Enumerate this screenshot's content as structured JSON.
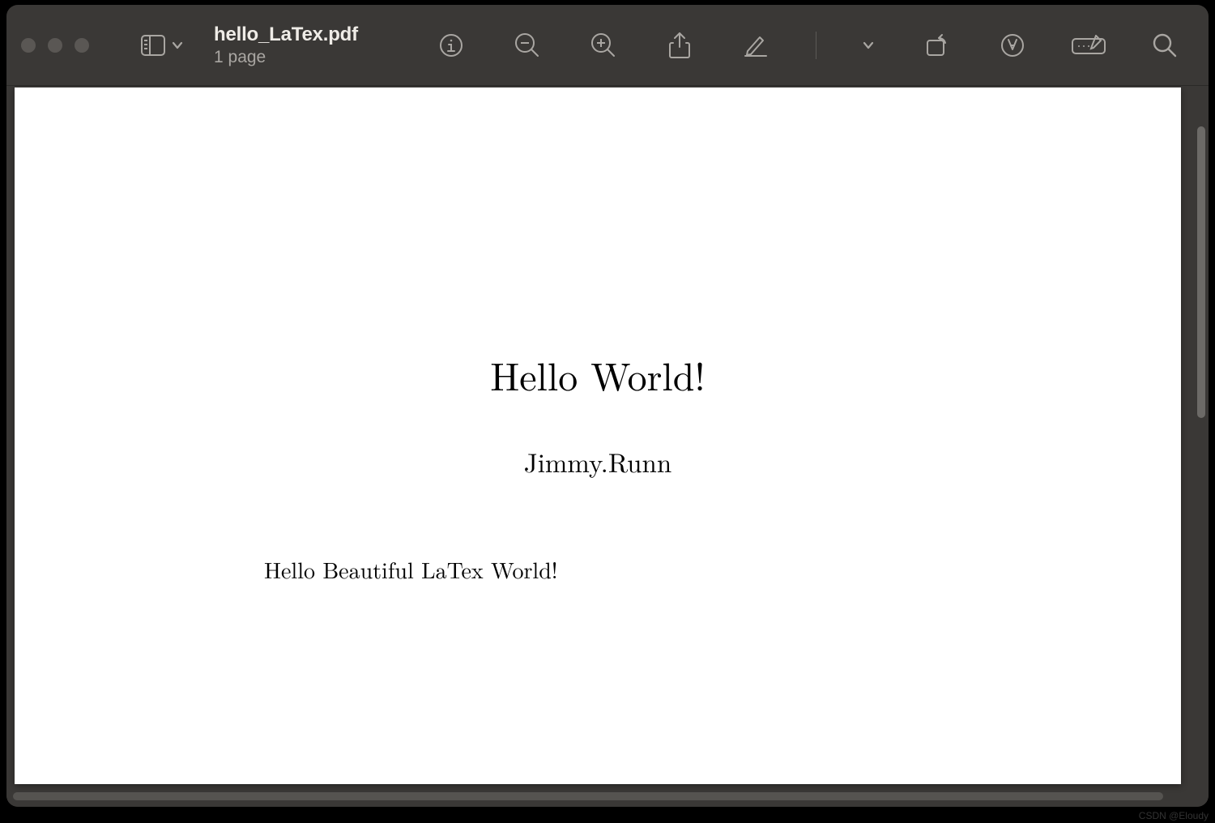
{
  "window": {
    "filename": "hello_LaTex.pdf",
    "subtitle": "1 page"
  },
  "icons": {
    "sidebar": "sidebar-icon",
    "chevron": "chevron-down-icon",
    "inspector": "info-icon",
    "zoom_out": "zoom-out-icon",
    "zoom_in": "zoom-in-icon",
    "share": "share-icon",
    "markup": "pencil-icon",
    "markup_chevron": "chevron-down-icon",
    "rotate": "rotate-icon",
    "highlight": "highlight-icon",
    "form": "form-fill-icon",
    "search": "search-icon"
  },
  "document": {
    "title": "Hello World!",
    "author": "Jimmy.Runn",
    "body": "Hello Beautiful LaTex World!"
  },
  "watermark": "CSDN @Eloudy"
}
